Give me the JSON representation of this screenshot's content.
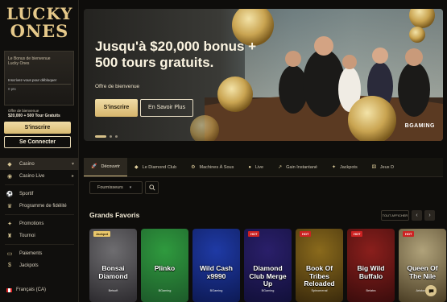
{
  "brand": {
    "line1": "LUCKY",
    "line2": "ONES"
  },
  "promo_card": {
    "title": "Le Bonus de bienvenue",
    "brand": "Lucky Ones",
    "row1": "Inscrivez-vous pour débloquer",
    "row2": "0 pts"
  },
  "welcome": {
    "label": "Offre de bienvenue",
    "amount": "$20,000 + 500 Tour Gratuits"
  },
  "sidebar": {
    "signup_label": "S'inscrire",
    "login_label": "Se Connecter",
    "items": [
      {
        "label": "Casino",
        "icon": "casino-icon",
        "glyph": "◆"
      },
      {
        "label": "Casino Live",
        "icon": "live-casino-icon",
        "glyph": "◉"
      },
      {
        "label": "Sportif",
        "icon": "sport-icon",
        "glyph": "⚽"
      },
      {
        "label": "Programme de fidélité",
        "icon": "crown-icon",
        "glyph": "♛"
      },
      {
        "label": "Promotions",
        "icon": "gift-icon",
        "glyph": "✦"
      },
      {
        "label": "Tournoi",
        "icon": "trophy-icon",
        "glyph": "♜"
      },
      {
        "label": "Paiements",
        "icon": "wallet-icon",
        "glyph": "▭"
      },
      {
        "label": "Jackpots",
        "icon": "jackpot-icon",
        "glyph": "$"
      }
    ],
    "language": "Français (CA)"
  },
  "hero": {
    "headline": "Jusqu'à $20,000 bonus + 500 tours gratuits.",
    "offer": "Offre de bienvenue",
    "cta_primary": "S'inscrire",
    "cta_secondary": "En Savoir Plus",
    "provider": "BGAMING",
    "slides": 3,
    "active_slide": 1
  },
  "categories": [
    {
      "label": "Découvrir",
      "icon": "rocket-icon",
      "glyph": "🚀",
      "active": true
    },
    {
      "label": "Le Diamond Club",
      "icon": "diamond-icon",
      "glyph": "◆"
    },
    {
      "label": "Machines À Sous",
      "icon": "slots-icon",
      "glyph": "⚙"
    },
    {
      "label": "Live",
      "icon": "live-icon",
      "glyph": "●"
    },
    {
      "label": "Gain Instantané",
      "icon": "instant-icon",
      "glyph": "↗"
    },
    {
      "label": "Jackpots",
      "icon": "jackpot-icon",
      "glyph": "✦"
    },
    {
      "label": "Jeux D",
      "icon": "dice-icon",
      "glyph": "⚄"
    }
  ],
  "filters": {
    "provider_label": "Fournisseurs"
  },
  "section": {
    "title": "Grands Favoris",
    "see_all": "TOUT AFFICHER"
  },
  "games": [
    {
      "name": "Bonsai Diamond",
      "provider": "Betsoft",
      "tag": "Jackpot",
      "bg1": "#6e6d70",
      "bg2": "#2c2a2e"
    },
    {
      "name": "Plinko",
      "provider": "BGaming",
      "tag": "",
      "bg1": "#2f9a3e",
      "bg2": "#1d5a2a"
    },
    {
      "name": "Wild Cash x9990",
      "provider": "BGaming",
      "tag": "",
      "bg1": "#1f3aa5",
      "bg2": "#0d1a55"
    },
    {
      "name": "Diamond Club Merge Up",
      "provider": "BGaming",
      "tag": "HOT",
      "bg1": "#2a1f6a",
      "bg2": "#12103a"
    },
    {
      "name": "Book Of Tribes Reloaded",
      "provider": "Spinomenal",
      "tag": "HOT",
      "bg1": "#8a6a1c",
      "bg2": "#3a2a0c"
    },
    {
      "name": "Big Wild Buffalo",
      "provider": "Belatra",
      "tag": "HOT",
      "bg1": "#8a1f1c",
      "bg2": "#3a0c0c"
    },
    {
      "name": "Queen Of The Nile",
      "provider": "Aristocrat",
      "tag": "HOT",
      "bg1": "#b0a27a",
      "bg2": "#4a3d24"
    }
  ],
  "colors": {
    "accent": "#d8c289",
    "background": "#0e0d0b",
    "panel": "#15140f"
  }
}
